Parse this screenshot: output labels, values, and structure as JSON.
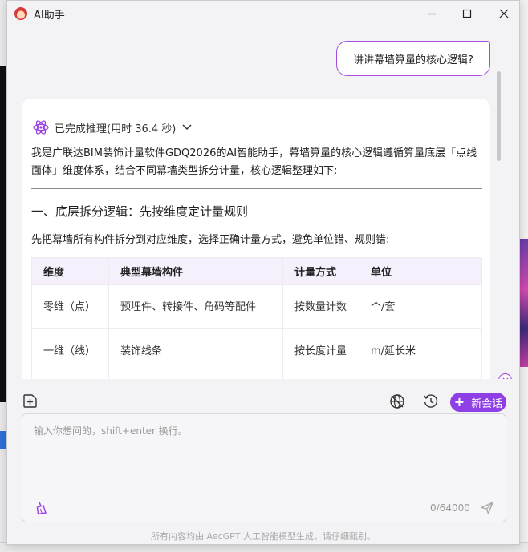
{
  "window": {
    "title": "AI助手"
  },
  "chat": {
    "user_message": "讲讲幕墙算量的核心逻辑?",
    "reasoning_status": "已完成推理(用时 36.4 秒)",
    "intro_text": "我是广联达BIM装饰计量软件GDQ2026的AI智能助手，幕墙算量的核心逻辑遵循算量底层「点线面体」维度体系，结合不同幕墙类型拆分计量，核心逻辑整理如下:",
    "section_title": "一、底层拆分逻辑：先按维度定计量规则",
    "section_desc": "先把幕墙所有构件拆分到对应维度，选择正确计量方式，避免单位错、规则错:",
    "table": {
      "headers": [
        "维度",
        "典型幕墙构件",
        "计量方式",
        "单位"
      ],
      "rows": [
        [
          "零维（点）",
          "预埋件、转接件、角码等配件",
          "按数量计数",
          "个/套"
        ],
        [
          "一维（线）",
          "装饰线条",
          "按长度计量",
          "m/延长米"
        ]
      ]
    }
  },
  "toolbar": {
    "new_chat_label": "新会话"
  },
  "input": {
    "placeholder": "输入你想问的，shift+enter 换行。",
    "counter": "0/64000"
  },
  "footer": {
    "note": "所有内容均由 AecGPT 人工智能模型生成，请仔细甄别。"
  },
  "colors": {
    "accent": "#8e3fe6",
    "bubble_border": "#a64be0",
    "table_header_bg": "#f6f0fc"
  },
  "icons": [
    "app-logo-icon",
    "minimize-icon",
    "maximize-icon",
    "close-icon",
    "atom-icon",
    "chevron-down-icon",
    "scroll-down-icon",
    "attach-file-icon",
    "web-search-icon",
    "history-icon",
    "plus-icon",
    "clear-broom-icon",
    "send-icon"
  ]
}
